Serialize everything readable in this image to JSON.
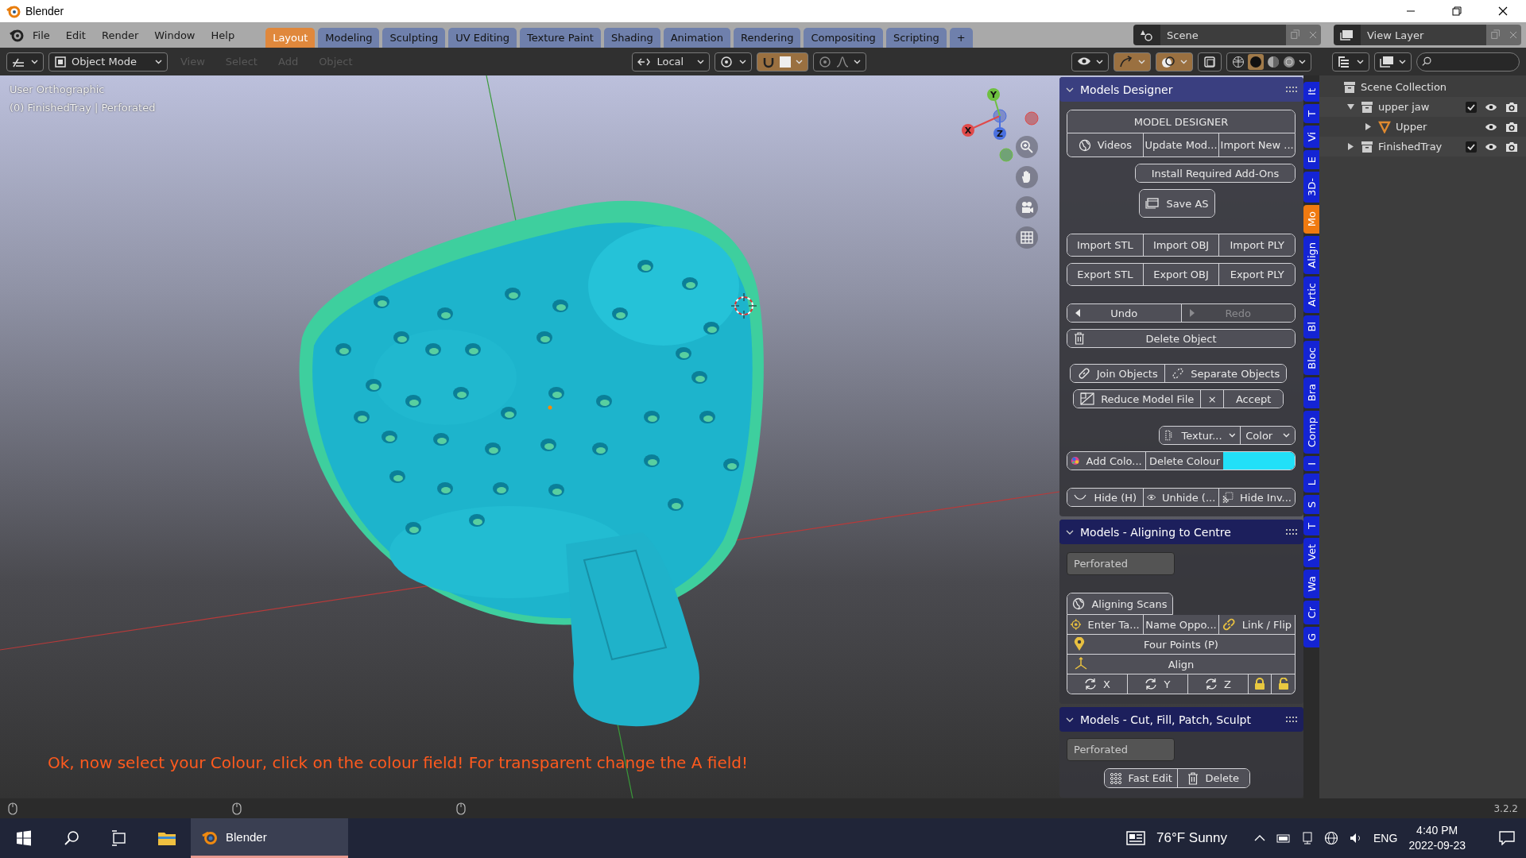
{
  "window": {
    "title": "Blender"
  },
  "menu": [
    "File",
    "Edit",
    "Render",
    "Window",
    "Help"
  ],
  "workspaces": [
    {
      "label": "Layout",
      "selected": true
    },
    {
      "label": "Modeling",
      "selected": false
    },
    {
      "label": "Sculpting",
      "selected": false
    },
    {
      "label": "UV Editing",
      "selected": false
    },
    {
      "label": "Texture Paint",
      "selected": false
    },
    {
      "label": "Shading",
      "selected": false
    },
    {
      "label": "Animation",
      "selected": false
    },
    {
      "label": "Rendering",
      "selected": false
    },
    {
      "label": "Compositing",
      "selected": false
    },
    {
      "label": "Scripting",
      "selected": false
    },
    {
      "label": "+",
      "selected": false
    }
  ],
  "scene": "Scene",
  "view_layer": "View Layer",
  "header": {
    "mode": "Object Mode",
    "menus": [
      "View",
      "Select",
      "Add",
      "Object"
    ],
    "orientation": "Local"
  },
  "viewport": {
    "view": "User Orthographic",
    "object_info": "(0) FinishedTray | Perforated",
    "gizmo": [
      "X",
      "Y",
      "Z"
    ],
    "message": "Ok, now select your Colour, click on the colour field! For transparent change the A field!"
  },
  "sidebar": {
    "panels": [
      {
        "title": "Models Designer",
        "expanded": true,
        "rows": [
          {
            "kind": "buttons",
            "items": [
              {
                "kind": "button",
                "label": "MODEL DESIGNER"
              }
            ]
          },
          {
            "kind": "buttons",
            "items": [
              {
                "kind": "button",
                "label": "Videos"
              },
              {
                "kind": "button",
                "label": "Update Mod..."
              },
              {
                "kind": "button",
                "label": "Import New ..."
              }
            ]
          },
          {
            "kind": "buttons",
            "items": [
              {
                "kind": "button",
                "label": "Install Required Add-Ons"
              }
            ]
          },
          {
            "kind": "buttons",
            "items": [
              {
                "kind": "button",
                "label": "Save AS"
              }
            ]
          },
          {
            "kind": "buttons",
            "items": [
              {
                "kind": "button",
                "label": "Import STL"
              },
              {
                "kind": "button",
                "label": "Import OBJ"
              },
              {
                "kind": "button",
                "label": "Import PLY"
              }
            ]
          },
          {
            "kind": "buttons",
            "items": [
              {
                "kind": "button",
                "label": "Export STL"
              },
              {
                "kind": "button",
                "label": "Export OBJ"
              },
              {
                "kind": "button",
                "label": "Export PLY"
              }
            ]
          },
          {
            "kind": "buttons",
            "items": [
              {
                "kind": "button",
                "label": "Undo",
                "disabled": false
              },
              {
                "kind": "button",
                "label": "Redo",
                "disabled": true
              }
            ]
          },
          {
            "kind": "buttons",
            "items": [
              {
                "kind": "button",
                "label": "Delete Object"
              }
            ]
          },
          {
            "kind": "buttons",
            "items": [
              {
                "kind": "button",
                "label": "Join Objects"
              },
              {
                "kind": "button",
                "label": "Separate Objects"
              }
            ]
          },
          {
            "kind": "buttons",
            "items": [
              {
                "kind": "button",
                "label": "Reduce Model File"
              },
              {
                "kind": "button",
                "label": "×"
              },
              {
                "kind": "button",
                "label": "Accept"
              }
            ]
          },
          {
            "kind": "buttons",
            "items": [
              {
                "kind": "dropdown",
                "label": "Textur..."
              },
              {
                "kind": "dropdown",
                "label": "Color"
              }
            ]
          },
          {
            "kind": "buttons",
            "items": [
              {
                "kind": "button",
                "label": "Add Colo..."
              },
              {
                "kind": "button",
                "label": "Delete Colour"
              },
              {
                "kind": "swatch",
                "color": "#22e0f8"
              }
            ]
          },
          {
            "kind": "buttons",
            "items": [
              {
                "kind": "button",
                "label": "Hide (H)"
              },
              {
                "kind": "button",
                "label": "Unhide (..."
              },
              {
                "kind": "button",
                "label": "Hide Inv..."
              }
            ]
          }
        ]
      },
      {
        "title": "Models - Aligning to Centre",
        "expanded": true,
        "rows": [
          {
            "kind": "field",
            "value": "Perforated"
          },
          {
            "kind": "buttons",
            "items": [
              {
                "kind": "button",
                "label": "Aligning Scans"
              }
            ]
          },
          {
            "kind": "buttons",
            "items": [
              {
                "kind": "button",
                "label": "Enter Ta..."
              },
              {
                "kind": "button",
                "label": "Name Oppo..."
              },
              {
                "kind": "button",
                "label": "Link / Flip"
              }
            ]
          },
          {
            "kind": "buttons",
            "items": [
              {
                "kind": "button",
                "label": "Four Points (P)"
              }
            ]
          },
          {
            "kind": "buttons",
            "items": [
              {
                "kind": "button",
                "label": "Align"
              }
            ]
          },
          {
            "kind": "buttons",
            "items": [
              {
                "kind": "button",
                "label": "X"
              },
              {
                "kind": "button",
                "label": "Y"
              },
              {
                "kind": "button",
                "label": "Z"
              },
              {
                "kind": "icon-button"
              },
              {
                "kind": "icon-button"
              }
            ]
          }
        ]
      },
      {
        "title": "Models - Cut, Fill, Patch, Sculpt",
        "expanded": true,
        "rows": [
          {
            "kind": "field",
            "value": "Perforated"
          },
          {
            "kind": "buttons",
            "items": [
              {
                "kind": "button",
                "label": "Fast Edit"
              },
              {
                "kind": "button",
                "label": "Delete"
              }
            ]
          }
        ]
      }
    ],
    "tabs": [
      {
        "label": "It",
        "selected": false
      },
      {
        "label": "T",
        "selected": false
      },
      {
        "label": "Vi",
        "selected": false
      },
      {
        "label": "E",
        "selected": false
      },
      {
        "label": "3D-",
        "selected": false
      },
      {
        "label": "Mo",
        "selected": true
      },
      {
        "label": "Align",
        "selected": false
      },
      {
        "label": "Artic",
        "selected": false
      },
      {
        "label": "Bl",
        "selected": false
      },
      {
        "label": "Bloc",
        "selected": false
      },
      {
        "label": "Bra",
        "selected": false
      },
      {
        "label": "Comp",
        "selected": false
      },
      {
        "label": "I",
        "selected": false
      },
      {
        "label": "L",
        "selected": false
      },
      {
        "label": "S",
        "selected": false
      },
      {
        "label": "T",
        "selected": false
      },
      {
        "label": "Vet",
        "selected": false
      },
      {
        "label": "Wa",
        "selected": false
      },
      {
        "label": "Cr",
        "selected": false
      },
      {
        "label": "G",
        "selected": false
      }
    ]
  },
  "outliner": {
    "items": [
      {
        "label": "Scene Collection",
        "kind": "collection",
        "children": [
          {
            "label": "upper jaw",
            "kind": "collection",
            "expanded": true,
            "checked": true,
            "children": [
              {
                "label": "Upper",
                "kind": "object",
                "expanded": false
              }
            ]
          },
          {
            "label": "FinishedTray",
            "kind": "collection",
            "expanded": false,
            "checked": true
          }
        ]
      }
    ]
  },
  "status_bar": {
    "version": "3.2.2"
  },
  "taskbar": {
    "apps": [
      {
        "label": "Blender",
        "selected": true
      }
    ],
    "weather": "76°F Sunny",
    "language": "ENG",
    "time": "4:40 PM",
    "date": "2022-09-23"
  }
}
